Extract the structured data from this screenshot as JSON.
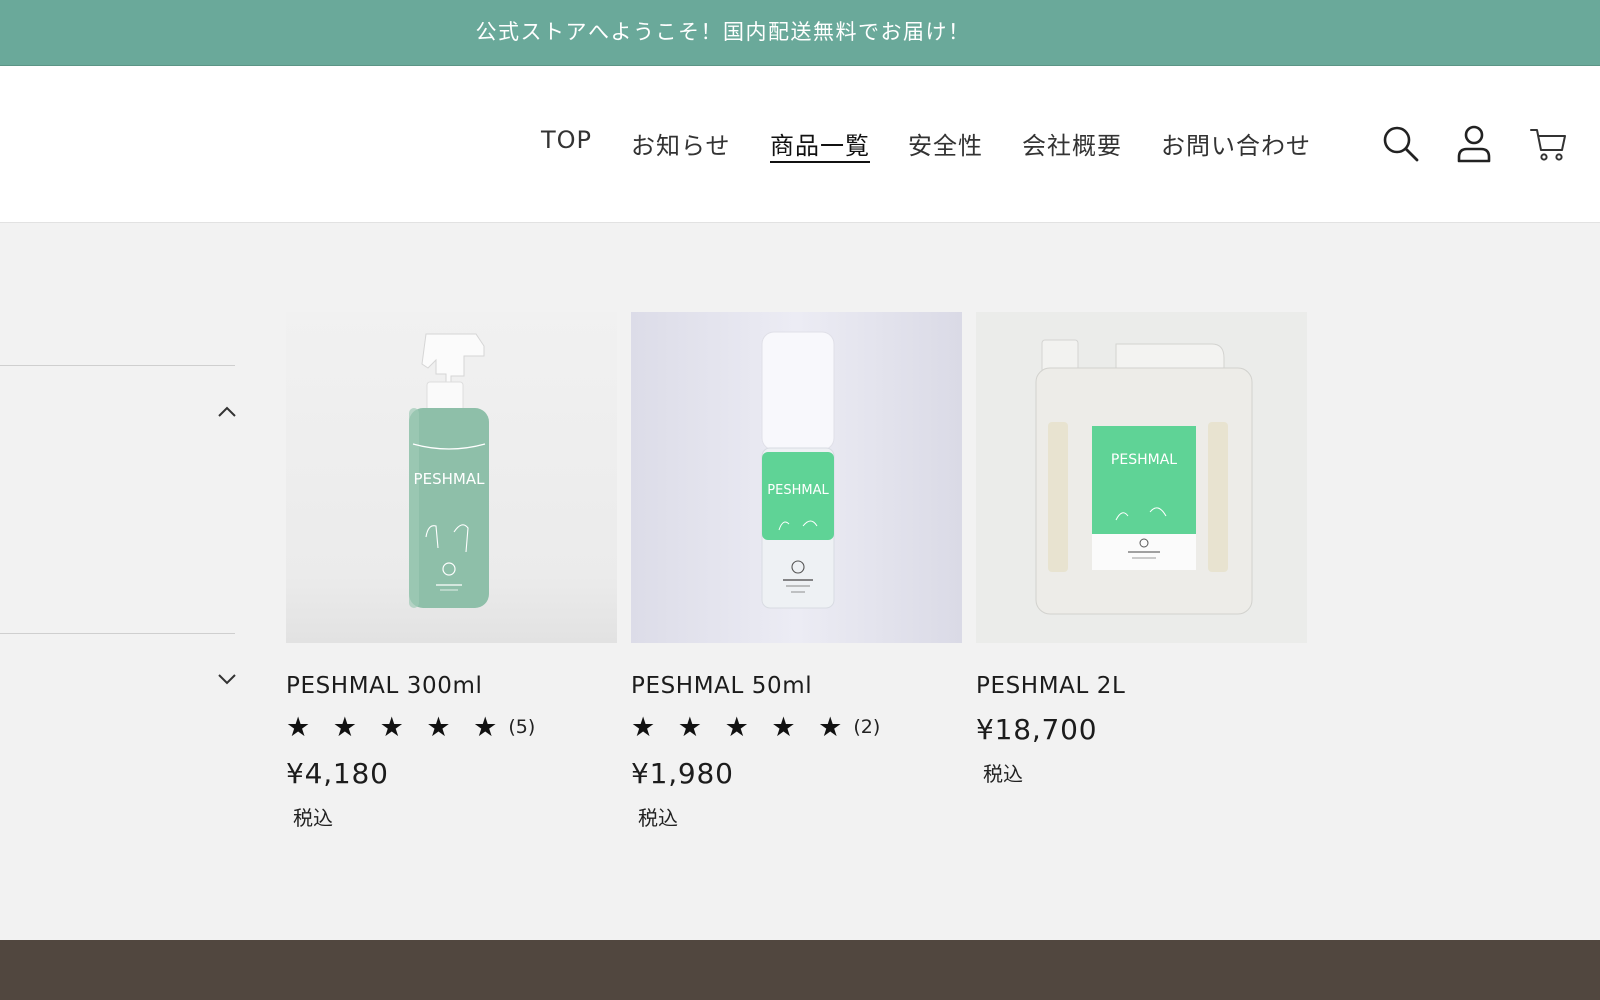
{
  "announcement": "公式ストアへようこそ！国内配送無料でお届け！",
  "nav": [
    {
      "label": "TOP",
      "active": false
    },
    {
      "label": "お知らせ",
      "active": false
    },
    {
      "label": "商品一覧",
      "active": true
    },
    {
      "label": "安全性",
      "active": false
    },
    {
      "label": "会社概要",
      "active": false
    },
    {
      "label": "お問い合わせ",
      "active": false
    }
  ],
  "header_icons": [
    "search-icon",
    "account-icon",
    "cart-icon"
  ],
  "filters": {
    "section1_state": "expanded",
    "section1_icon": "chevron-up-icon",
    "section2_state": "collapsed",
    "section2_icon": "chevron-down-icon"
  },
  "products": [
    {
      "title": "PESHMAL 300ml",
      "stars": "★ ★ ★ ★ ★",
      "rating": 5,
      "review_count": "(5)",
      "price": "¥4,180",
      "tax": "税込",
      "image_label": "PESHMAL"
    },
    {
      "title": "PESHMAL 50ml",
      "stars": "★ ★ ★ ★ ★",
      "rating": 5,
      "review_count": "(2)",
      "price": "¥1,980",
      "tax": "税込",
      "image_label": "PESHMAL"
    },
    {
      "title": "PESHMAL 2L",
      "price": "¥18,700",
      "tax": "税込",
      "image_label": "PESHMAL"
    }
  ],
  "colors": {
    "announcement_bg": "#6aa99a",
    "page_bg": "#f2f2f2",
    "footer_bg": "#51473f",
    "bottle_green": "#8ebfa9",
    "label_green": "#5fd396"
  }
}
